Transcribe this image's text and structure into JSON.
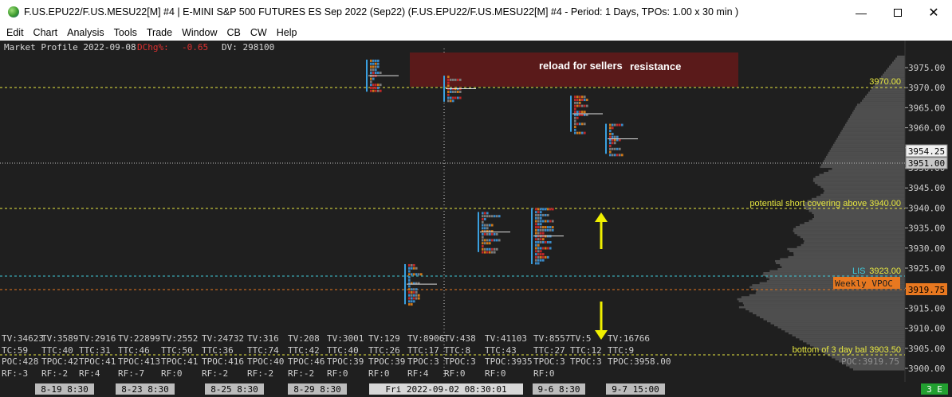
{
  "window": {
    "title": "F.US.EPU22/F.US.MESU22[M]  #4 | E-MINI S&P 500 FUTURES ES Sep 2022 (Sep22) (F.US.EPU22/F.US.MESU22[M]  #4 - Period: 1 Days, TPOs: 1.00 x 30 min  )",
    "minimize_icon": "minimize-icon",
    "maximize_icon": "maximize-icon",
    "close_icon": "close-icon"
  },
  "menu": [
    "Edit",
    "Chart",
    "Analysis",
    "Tools",
    "Trade",
    "Window",
    "CB",
    "CW",
    "Help"
  ],
  "chart": {
    "header": {
      "label": "Market Profile 2022-09-08",
      "dchg_label": "DChg%:",
      "dchg_value": "-0.65",
      "dv": "DV: 298100"
    },
    "colors": {
      "background": "#1f1f1f",
      "level_yellow": "#e8e840",
      "lis_cyan": "#40c8d8",
      "vpoc_orange": "#e87820",
      "resistance_zone": "#5a1a1a",
      "volume_profile": "#5a5a5a",
      "arrow_yellow": "#f0f000"
    },
    "price_axis": {
      "ticks": [
        "3975.00",
        "3970.00",
        "3965.00",
        "3960.00",
        "3955.00",
        "3950.00",
        "3945.00",
        "3940.00",
        "3935.00",
        "3930.00",
        "3925.00",
        "3920.00",
        "3915.00",
        "3910.00",
        "3905.00",
        "3900.00"
      ],
      "last_price": "3954.25",
      "reference_price": "3951.00",
      "vpoc_price": "3919.75"
    },
    "levels": {
      "level_3970": "3970.00",
      "short_covering": "potential short covering above  3940.00",
      "lis_label": "LIS",
      "lis_value": "3923.00",
      "weekly_vpoc": "Weekly VPOC",
      "bottom_bal": "bottom of 3 day bal  3903.50",
      "poc_label": "POC:3919.75"
    },
    "annotations": {
      "reload": "reload for sellers  ",
      "reload_overlap": "resistance",
      "resistance": "resistance"
    },
    "stats": {
      "tv_row": [
        "TV:34623",
        "TV:3589",
        "TV:2916",
        "TV:22899",
        "TV:2552",
        "TV:24732",
        "TV:316",
        "TV:208",
        "TV:3001",
        "TV:129",
        "TV:8906",
        "TV:438",
        "TV:41103",
        "TV:8557",
        "TV:5",
        "TV:16766"
      ],
      "ttc_row": [
        "TC:59",
        "TTC:40",
        "TTC:31",
        "TTC:46",
        "TTC:50",
        "TTC:36",
        "TTC:74",
        "TTC:42",
        "TTC:40",
        "TTC:26",
        "TTC:17",
        "TTC:8",
        "TTC:43",
        "TTC:27",
        "TTC:12",
        "TTC:9"
      ],
      "tpoc_row": [
        "POC:428",
        "TPOC:42",
        "TPOC:41",
        "TPOC:413",
        "TPOC:41",
        "TPOC:416",
        "TPOC:40",
        "TPOC:46",
        "TPOC:39",
        "TPOC:39",
        "TPOC:3",
        "TPOC:3",
        "TPOC:3935",
        "TPOC:3",
        "TPOC:3",
        "TPOC:3958.00"
      ],
      "rf_row": [
        "RF:-3",
        "RF:-2",
        "RF:4",
        "RF:-7",
        "RF:0",
        "RF:-2",
        "RF:-2",
        "RF:-2",
        "RF:0",
        "RF:0",
        "RF:4",
        "RF:0",
        "RF:0",
        "RF:0"
      ]
    },
    "time_axis": {
      "labels": [
        "8-19  8:30",
        "8-23  8:30",
        "8-25  8:30",
        "8-29  8:30",
        "Fri 2022-09-02  08:30:01",
        "9-6  8:30",
        "9-7  15:00"
      ],
      "badge": "3 E"
    }
  }
}
